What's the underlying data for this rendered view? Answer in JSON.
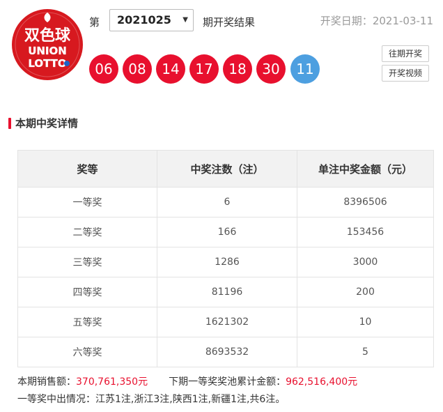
{
  "logo": {
    "title_text": "双色球",
    "union_text": "UNION",
    "lotto_text": "LOTTO",
    "brand_color": "#d7191f"
  },
  "header": {
    "issue_prefix": "第",
    "issue_value": "2021025",
    "issue_suffix": "期开奖结果",
    "draw_date_label": "开奖日期：",
    "draw_date_value": "2021-03-11"
  },
  "balls": {
    "red": [
      "06",
      "08",
      "14",
      "17",
      "18",
      "30"
    ],
    "blue": [
      "11"
    ],
    "red_color": "#e8102e",
    "blue_color": "#4d9fe0"
  },
  "links": {
    "history": "往期开奖",
    "video": "开奖视频"
  },
  "section": {
    "title": "本期中奖详情"
  },
  "table": {
    "headers": [
      "奖等",
      "中奖注数（注）",
      "单注中奖金额（元）"
    ],
    "rows": [
      [
        "一等奖",
        "6",
        "8396506"
      ],
      [
        "二等奖",
        "166",
        "153456"
      ],
      [
        "三等奖",
        "1286",
        "3000"
      ],
      [
        "四等奖",
        "81196",
        "200"
      ],
      [
        "五等奖",
        "1621302",
        "10"
      ],
      [
        "六等奖",
        "8693532",
        "5"
      ]
    ]
  },
  "summary": {
    "sales_label": "本期销售额：",
    "sales_value": "370,761,350元",
    "pool_label": "下期一等奖奖池累计金额：",
    "pool_value": "962,516,400元",
    "first_prize_info": "一等奖中出情况：江苏1注,浙江3注,陕西1注,新疆1注,共6注。"
  }
}
